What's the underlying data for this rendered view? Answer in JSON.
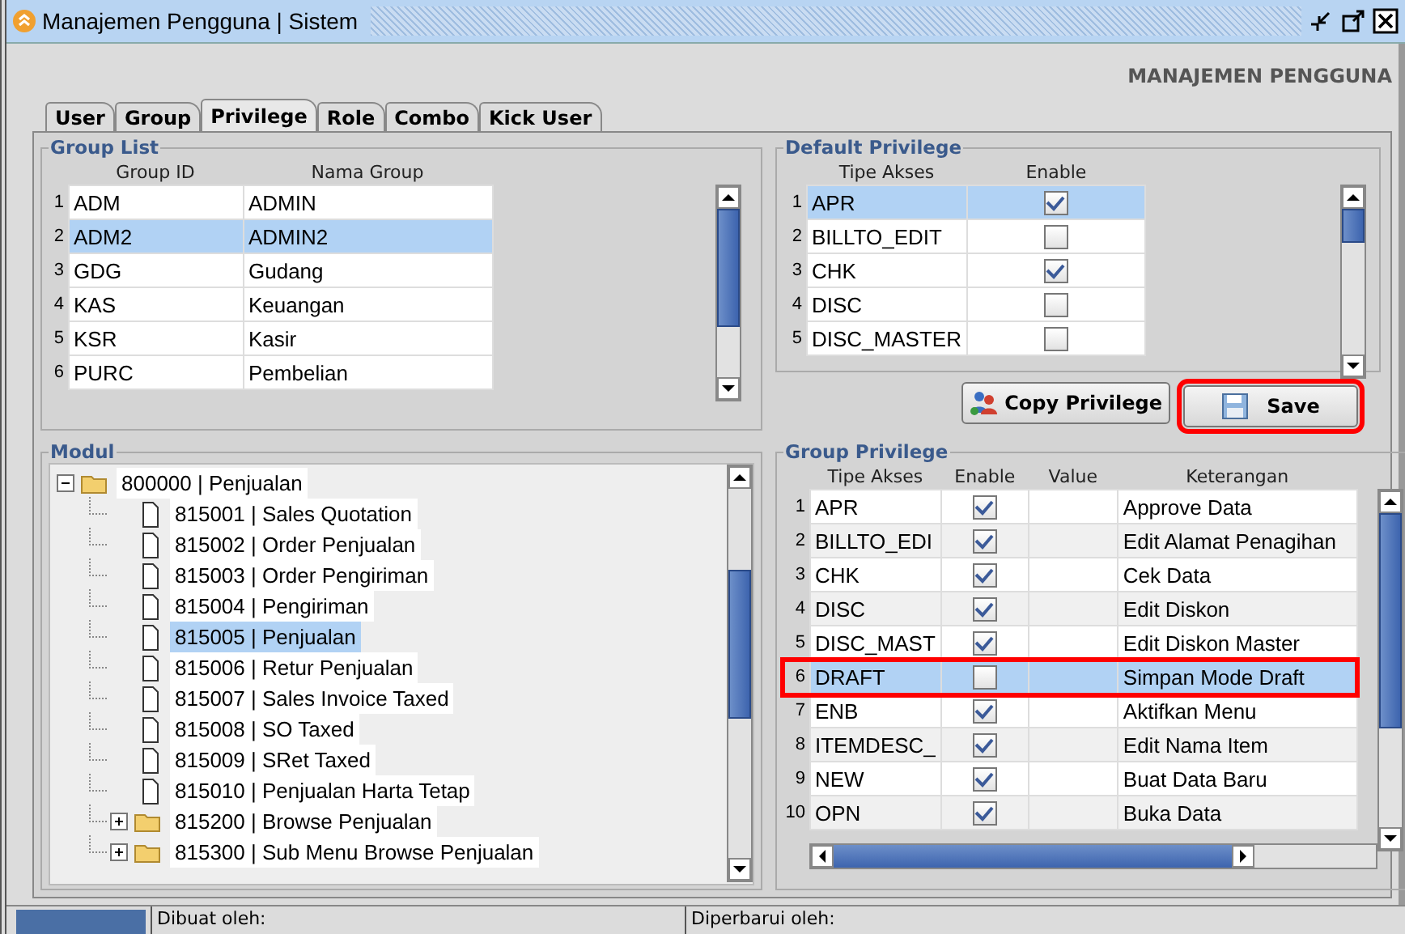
{
  "window": {
    "title": "Manajemen Pengguna | Sistem"
  },
  "heading": "MANAJEMEN PENGGUNA",
  "tabs": [
    {
      "label": "User",
      "selected": false
    },
    {
      "label": "Group",
      "selected": false
    },
    {
      "label": "Privilege",
      "selected": true
    },
    {
      "label": "Role",
      "selected": false
    },
    {
      "label": "Combo",
      "selected": false
    },
    {
      "label": "Kick User",
      "selected": false
    }
  ],
  "group_list": {
    "title": "Group List",
    "columns": [
      "Group ID",
      "Nama Group"
    ],
    "rows": [
      {
        "no": "1",
        "group_id": "ADM",
        "nama_group": "ADMIN",
        "selected": false
      },
      {
        "no": "2",
        "group_id": "ADM2",
        "nama_group": "ADMIN2",
        "selected": true
      },
      {
        "no": "3",
        "group_id": "GDG",
        "nama_group": "Gudang",
        "selected": false
      },
      {
        "no": "4",
        "group_id": "KAS",
        "nama_group": "Keuangan",
        "selected": false
      },
      {
        "no": "5",
        "group_id": "KSR",
        "nama_group": "Kasir",
        "selected": false
      },
      {
        "no": "6",
        "group_id": "PURC",
        "nama_group": "Pembelian",
        "selected": false
      }
    ]
  },
  "default_privilege": {
    "title": "Default Privilege",
    "columns": [
      "Tipe Akses",
      "Enable"
    ],
    "rows": [
      {
        "no": "1",
        "tipe_akses": "APR",
        "enable": true,
        "selected": true
      },
      {
        "no": "2",
        "tipe_akses": "BILLTO_EDIT",
        "enable": false,
        "selected": false
      },
      {
        "no": "3",
        "tipe_akses": "CHK",
        "enable": true,
        "selected": false
      },
      {
        "no": "4",
        "tipe_akses": "DISC",
        "enable": false,
        "selected": false
      },
      {
        "no": "5",
        "tipe_akses": "DISC_MASTER",
        "enable": false,
        "selected": false
      }
    ]
  },
  "buttons": [
    {
      "label": "Copy Privilege",
      "kind": "copy",
      "highlighted": false
    },
    {
      "label": "Save",
      "kind": "save",
      "highlighted": true
    }
  ],
  "modul": {
    "title": "Modul",
    "tree": [
      {
        "label": "800000 | Penjualan",
        "kind": "folder",
        "expanded": true,
        "selected": false,
        "children": [
          {
            "label": "815001 | Sales Quotation",
            "kind": "leaf",
            "selected": false
          },
          {
            "label": "815002 | Order Penjualan",
            "kind": "leaf",
            "selected": false
          },
          {
            "label": "815003 | Order Pengiriman",
            "kind": "leaf",
            "selected": false
          },
          {
            "label": "815004 | Pengiriman",
            "kind": "leaf",
            "selected": false
          },
          {
            "label": "815005 | Penjualan",
            "kind": "leaf",
            "selected": true
          },
          {
            "label": "815006 | Retur Penjualan",
            "kind": "leaf",
            "selected": false
          },
          {
            "label": "815007 | Sales Invoice Taxed",
            "kind": "leaf",
            "selected": false
          },
          {
            "label": "815008 | SO Taxed",
            "kind": "leaf",
            "selected": false
          },
          {
            "label": "815009 | SRet Taxed",
            "kind": "leaf",
            "selected": false
          },
          {
            "label": "815010 | Penjualan Harta Tetap",
            "kind": "leaf",
            "selected": false
          },
          {
            "label": "815200 | Browse Penjualan",
            "kind": "folder",
            "expanded": false,
            "selected": false
          },
          {
            "label": "815300 | Sub Menu Browse Penjualan",
            "kind": "folder",
            "expanded": false,
            "selected": false
          }
        ]
      }
    ]
  },
  "group_privilege": {
    "title": "Group Privilege",
    "columns": [
      "Tipe Akses",
      "Enable",
      "Value",
      "Keterangan"
    ],
    "rows": [
      {
        "no": "1",
        "tipe_akses": "APR",
        "enable": true,
        "keterangan": "Approve Data",
        "selected": false,
        "highlighted": false
      },
      {
        "no": "2",
        "tipe_akses": "BILLTO_EDI",
        "enable": true,
        "keterangan": "Edit Alamat Penagihan",
        "selected": false,
        "highlighted": false
      },
      {
        "no": "3",
        "tipe_akses": "CHK",
        "enable": true,
        "keterangan": "Cek Data",
        "selected": false,
        "highlighted": false
      },
      {
        "no": "4",
        "tipe_akses": "DISC",
        "enable": true,
        "keterangan": "Edit Diskon",
        "selected": false,
        "highlighted": false
      },
      {
        "no": "5",
        "tipe_akses": "DISC_MAST",
        "enable": true,
        "keterangan": "Edit Diskon Master",
        "selected": false,
        "highlighted": false
      },
      {
        "no": "6",
        "tipe_akses": "DRAFT",
        "enable": false,
        "keterangan": "Simpan Mode Draft",
        "selected": true,
        "highlighted": true
      },
      {
        "no": "7",
        "tipe_akses": "ENB",
        "enable": true,
        "keterangan": "Aktifkan Menu",
        "selected": false,
        "highlighted": false
      },
      {
        "no": "8",
        "tipe_akses": "ITEMDESC_",
        "enable": true,
        "keterangan": "Edit Nama Item",
        "selected": false,
        "highlighted": false
      },
      {
        "no": "9",
        "tipe_akses": "NEW",
        "enable": true,
        "keterangan": "Buat Data Baru",
        "selected": false,
        "highlighted": false
      },
      {
        "no": "10",
        "tipe_akses": "OPN",
        "enable": true,
        "keterangan": "Buka Data",
        "selected": false,
        "highlighted": false
      }
    ]
  },
  "status_bar": {
    "created_by": "Dibuat oleh:",
    "updated_by": "Diperbarui oleh:"
  }
}
